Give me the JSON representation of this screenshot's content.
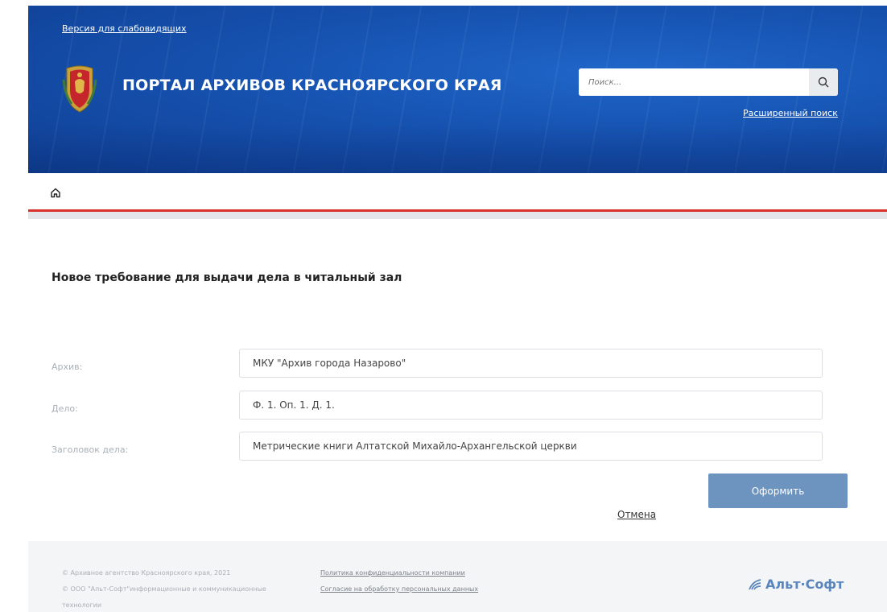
{
  "header": {
    "accessibility_link": "Версия для слабовидящих",
    "title": "ПОРТАЛ АРХИВОВ КРАСНОЯРСКОГО КРАЯ",
    "search_placeholder": "Поиск...",
    "advanced_search": "Расширенный поиск",
    "search_icon": "magnifier-icon",
    "brand_color": "#1652b0"
  },
  "nav": {
    "home_icon": "home-icon",
    "accent_color": "#d8312c"
  },
  "form": {
    "title": "Новое требование для выдачи дела в читальный зал",
    "fields": [
      {
        "label": "Архив:",
        "value": "МКУ \"Архив города Назарово\""
      },
      {
        "label": "Дело:",
        "value": "Ф. 1. Оп. 1. Д. 1."
      },
      {
        "label": "Заголовок дела:",
        "value": "Метрические книги Алтатской Михайло-Архангельской церкви"
      }
    ],
    "cancel_label": "Отмена",
    "submit_label": "Оформить",
    "submit_color": "#6d93bf"
  },
  "footer": {
    "copyright_agency": "© Архивное агентство Красноярского края, 2021",
    "copyright_company_line1": "© ООО \"Альт-Софт\"информационные и коммуникационные",
    "copyright_company_line2": "технологии",
    "privacy_policy": "Политика конфиденциальности компании",
    "data_consent": "Согласие на обработку персональных данных",
    "brand_name": "Альт·Софт",
    "brand_color": "#5a86bd"
  }
}
